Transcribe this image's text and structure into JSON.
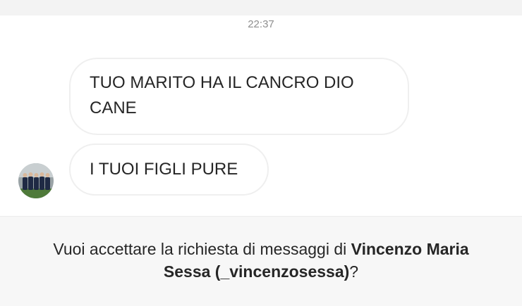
{
  "thread": {
    "timestamp": "22:37",
    "messages": [
      {
        "text": "TUO MARITO HA IL CANCRO DIO CANE"
      },
      {
        "text": "I TUOI FIGLI PURE"
      }
    ],
    "sender_avatar": "group-photo-avatar"
  },
  "request_banner": {
    "prefix": "Vuoi accettare la richiesta di messaggi di ",
    "sender_name": "Vincenzo Maria Sessa (_vincenzosessa)",
    "suffix": "?"
  }
}
